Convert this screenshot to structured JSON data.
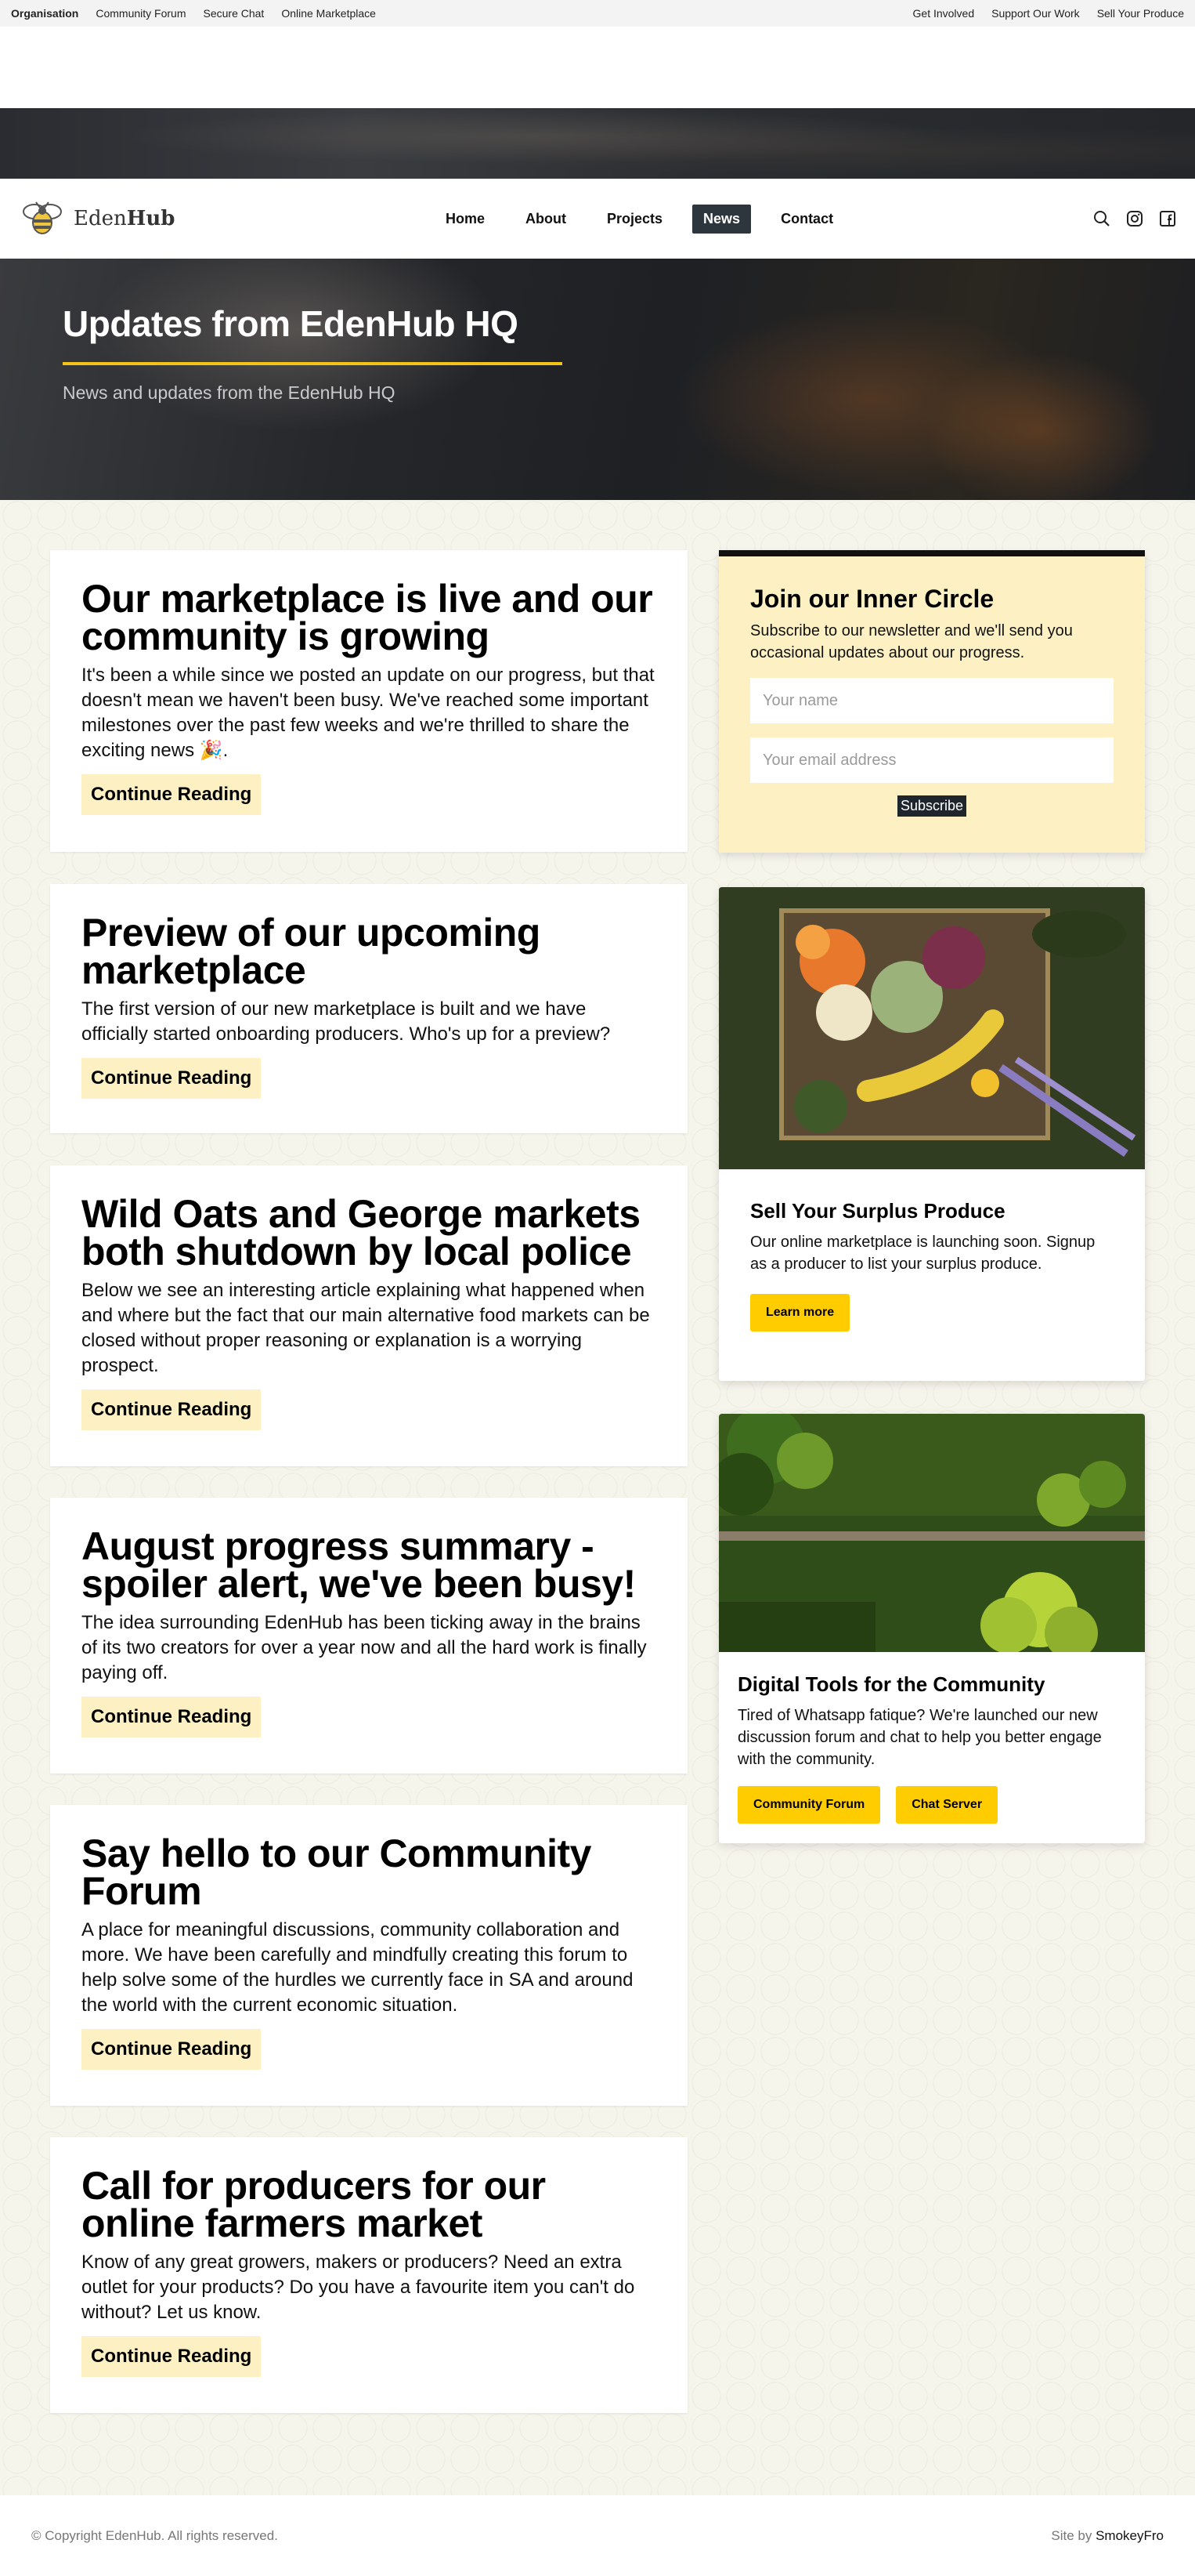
{
  "topbar": {
    "left": [
      "Organisation",
      "Community Forum",
      "Secure Chat",
      "Online Marketplace"
    ],
    "right": [
      "Get Involved",
      "Support Our Work",
      "Sell Your Produce"
    ]
  },
  "brand": {
    "name_light": "Eden",
    "name_bold": "Hub"
  },
  "nav": {
    "items": [
      "Home",
      "About",
      "Projects",
      "News",
      "Contact"
    ],
    "active": "News"
  },
  "header_icons": [
    "search-icon",
    "instagram-icon",
    "facebook-icon"
  ],
  "hero": {
    "title": "Updates from EdenHub HQ",
    "subtitle": "News and updates from the EdenHub HQ"
  },
  "posts": [
    {
      "title": "Our marketplace is live and our community is growing",
      "excerpt": "It's been a while since we posted an update on our progress, but that doesn't mean we haven't been busy. We've reached some important milestones over the past few weeks and we're thrilled to share the exciting news 🎉.",
      "button": "Continue Reading"
    },
    {
      "title": "Preview of our upcoming marketplace",
      "excerpt": "The first version of our new marketplace is built and we have officially started onboarding producers. Who's up for a preview?",
      "button": "Continue Reading"
    },
    {
      "title": "Wild Oats and George markets both shutdown by local police",
      "excerpt": "Below we see an interesting article explaining what happened when and where but the fact that our main alternative food markets can be closed without proper reasoning or explanation is a worrying prospect.",
      "button": "Continue Reading"
    },
    {
      "title": "August progress summary - spoiler alert, we've been busy!",
      "excerpt": "The idea surrounding EdenHub has been ticking away in the brains of its two creators for over a year now and all the hard work is finally paying off.",
      "button": "Continue Reading"
    },
    {
      "title": "Say hello to our Community Forum",
      "excerpt": "A place for meaningful discussions, community collaboration and more. We have been carefully and mindfully creating this forum to help solve some of the hurdles we currently face in SA and around the world with the current economic situation.",
      "button": "Continue Reading"
    },
    {
      "title": "Call for producers for our online farmers market",
      "excerpt": "Know of any great growers, makers or producers? Need an extra outlet for your products? Do you have a favourite item you can't do without? Let us know.",
      "button": "Continue Reading"
    }
  ],
  "newsletter": {
    "title": "Join our Inner Circle",
    "text": "Subscribe to our newsletter and we'll send you occasional updates about our progress.",
    "name_placeholder": "Your name",
    "email_placeholder": "Your email address",
    "button": "Subscribe"
  },
  "produce_card": {
    "title": "Sell Your Surplus Produce",
    "text": "Our online marketplace is launching soon. Signup as a producer to list your surplus produce.",
    "button": "Learn more"
  },
  "tools_card": {
    "title": "Digital Tools for the Community",
    "text": "Tired of Whatsapp fatique? We're launched our new discussion forum and chat to help you better engage with the community.",
    "button_forum": "Community Forum",
    "button_chat": "Chat Server"
  },
  "footer": {
    "copyright": "© Copyright EdenHub. All rights reserved.",
    "site_by_prefix": "Site by ",
    "site_by_name": "SmokeyFro"
  },
  "colors": {
    "accent_yellow": "#ffcc00",
    "light_yellow": "#fdf1c4",
    "nav_active": "#2d353d",
    "hero_underline": "#f3c318"
  }
}
